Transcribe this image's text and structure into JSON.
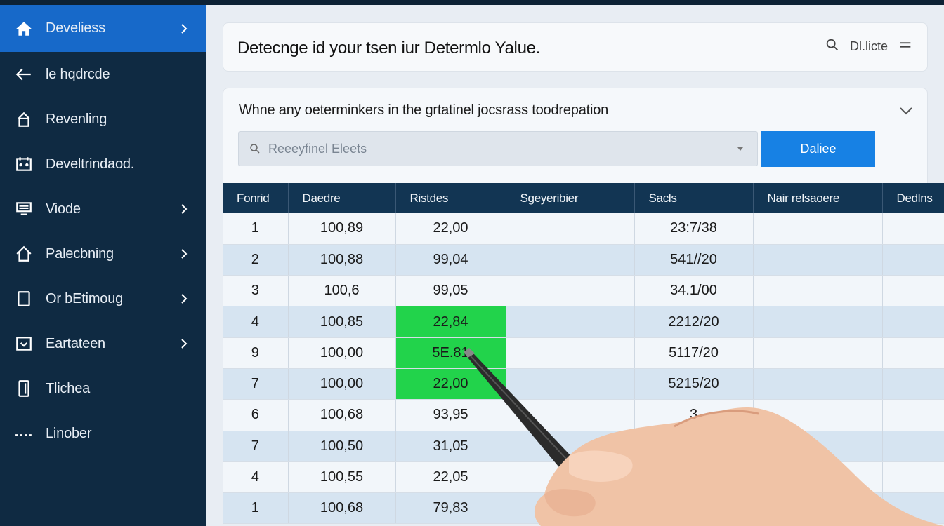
{
  "colors": {
    "sidebar_bg": "#0f2a42",
    "sidebar_active": "#1769c9",
    "accent": "#1781e4",
    "table_header": "#123553",
    "highlight": "#22d34b"
  },
  "sidebar": {
    "items": [
      {
        "label": "Develiess",
        "icon": "home-icon",
        "active": true,
        "chevron": true
      },
      {
        "label": "le hqdrcde",
        "icon": "arrow-left-icon",
        "chevron": false
      },
      {
        "label": "Revenling",
        "icon": "upload-icon",
        "chevron": false
      },
      {
        "label": "Develtrindaod.",
        "icon": "calendar-icon",
        "chevron": false
      },
      {
        "label": "Viode",
        "icon": "monitor-icon",
        "chevron": true
      },
      {
        "label": "Palecbning",
        "icon": "house-outline-icon",
        "chevron": true
      },
      {
        "label": "Or bEtimoug",
        "icon": "document-icon",
        "chevron": true
      },
      {
        "label": "Eartateen",
        "icon": "checkbox-icon",
        "chevron": true
      },
      {
        "label": "Tlichea",
        "icon": "phone-icon",
        "chevron": false
      },
      {
        "label": "Linober",
        "icon": "dash-icon",
        "chevron": false
      }
    ]
  },
  "header": {
    "title": "Detecnge id your tsen iur Determlo Yalue.",
    "right_label": "Dl.licte",
    "search_icon": "search-icon",
    "menu_icon": "menu-icon"
  },
  "filter": {
    "description": "Whne any oeterminkers in the grtatinel jocsrass toodrepation",
    "search_placeholder": "Reeeyfinel Eleets",
    "apply_label": "Daliee"
  },
  "table": {
    "columns": [
      "Fonrid",
      "Daedre",
      "Ristdes",
      "Sgeyeribier",
      "Sacls",
      "Nair relsaoere",
      "Dedlns"
    ],
    "rows": [
      [
        "1",
        "100,89",
        "22,00",
        "",
        "23:7/38",
        "",
        ""
      ],
      [
        "2",
        "100,88",
        "99,04",
        "",
        "541//20",
        "",
        ""
      ],
      [
        "3",
        "100,6",
        "99,05",
        "",
        "34.1/00",
        "",
        ""
      ],
      [
        "4",
        "100,85",
        "22,84",
        "",
        "2212/20",
        "",
        ""
      ],
      [
        "9",
        "100,00",
        "5E.81",
        "",
        "5117/20",
        "",
        ""
      ],
      [
        "7",
        "100,00",
        "22,00",
        "",
        "5215/20",
        "",
        ""
      ],
      [
        "6",
        "100,68",
        "93,95",
        "",
        "3",
        "",
        ""
      ],
      [
        "7",
        "100,50",
        "31,05",
        "",
        "",
        "",
        ""
      ],
      [
        "4",
        "100,55",
        "22,05",
        "",
        "",
        "",
        ""
      ],
      [
        "1",
        "100,68",
        "79,83",
        "",
        "",
        "",
        ""
      ]
    ],
    "highlighted_rows": [
      3,
      4,
      5
    ],
    "highlighted_column": 2
  }
}
